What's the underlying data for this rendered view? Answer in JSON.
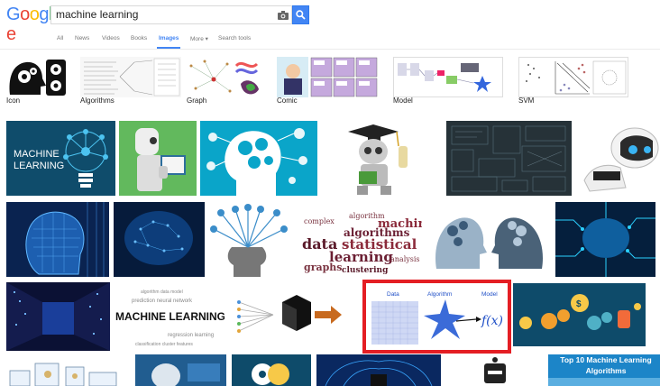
{
  "logo": {
    "letters": [
      "G",
      "o",
      "o",
      "g",
      "l",
      "e"
    ],
    "colors": [
      "#4285f4",
      "#ea4335",
      "#fbbc05",
      "#4285f4",
      "#34a853",
      "#ea4335"
    ]
  },
  "search": {
    "query": "machine learning",
    "camera_icon": "camera-icon",
    "search_icon": "magnifier-icon"
  },
  "tabs": {
    "all": "All",
    "news": "News",
    "videos": "Videos",
    "books": "Books",
    "images": "Images",
    "more": "More ▾",
    "tools": "Search tools"
  },
  "related": {
    "icon": "Icon",
    "algorithms": "Algorithms",
    "graph": "Graph",
    "comic": "Comic",
    "model": "Model",
    "svm": "SVM"
  },
  "tiles": {
    "ml_bulb": {
      "line1": "MACHINE",
      "line2": "LEARNING"
    },
    "wordcloud": {
      "w1": "complex",
      "w2": "algorithm",
      "w3": "machine",
      "w4": "algorithms",
      "w5": "data",
      "w6": "statistical",
      "w7": "learning",
      "w8": "graphs",
      "w9": "clustering",
      "w10": "analysis"
    },
    "ml_text_cloud": {
      "text": "MACHINE LEARNING"
    },
    "fx_diagram": {
      "data": "Data",
      "algorithm": "Algorithm",
      "model": "Model",
      "fx": "f(x)"
    },
    "top10": {
      "line1": "Top 10 Machine Learning",
      "line2": "Algorithms"
    }
  },
  "colors": {
    "accent": "#4285f4",
    "highlight": "#e41e24",
    "dark_blue": "#0f4c6b"
  }
}
